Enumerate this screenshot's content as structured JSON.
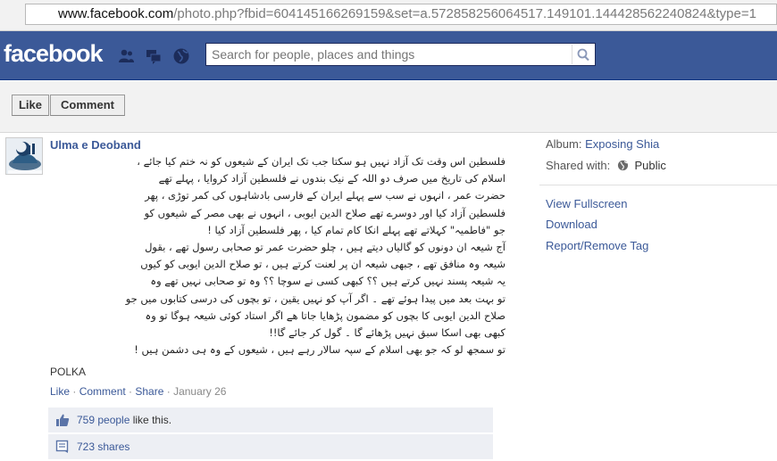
{
  "browser": {
    "url_host": "www.facebook.com",
    "url_rest": "/photo.php?fbid=604145166269159&set=a.572858256064517.149101.144428562240824&type=1"
  },
  "header": {
    "logo": "facebook",
    "search_placeholder": "Search for people, places and things",
    "icons": [
      "friends-icon",
      "messages-icon",
      "notifications-globe-icon",
      "search-icon"
    ]
  },
  "actions": {
    "like_label": "Like",
    "comment_label": "Comment"
  },
  "post": {
    "author": "Ulma e Deoband",
    "caption_lines": [
      "فلسطین اس وقت تک آزاد نہیں ہو سکتا جب تک ایران کے شیعوں کو نہ ختم کیا جائے ،",
      "اسلام کی تاریخ میں صرف دو اللہ کے نیک بندوں نے فلسطین آزاد کروایا ، پہلے تھے",
      "حضرت عمر ، انہوں نے سب سے پہلے ایران کے فارسی بادشاہوں کی کمر توڑی ، پھر",
      "فلسطین آزاد کیا اور دوسرے تھے صلاح الدین ایوبی ، انہوں نے بھی مصر کے شیعوں کو",
      "جو \"فاطمیہ\" کہلاتے تھے پہلے انکا کام تمام کیا ، پھر فلسطین آزاد کیا !",
      "آج شیعہ ان دونوں کو گالیاں دیتے ہیں ، چلو حضرت عمر تو صحابی رسول تھے ، بقول",
      "شیعہ وہ منافق تھے ، جبھی شیعہ ان پر لعنت کرتے ہیں ، تو صلاح الدین ایوبی کو کیوں",
      "یہ شیعہ پسند نہیں کرتے ہیں ؟؟ کبھی کسی نے سوچا ؟؟ وہ تو صحابی نہیں تھے وہ",
      "تو بہت بعد میں پیدا ہوئے تھے ۔ اگر آپ کو نہیں یقین ، تو بچوں کی درسی کتابوں میں جو",
      "صلاح الدین ایوبی کا بچوں کو مضمون پڑھایا جاتا ھے اگر استاد کوئی شیعہ ہوگا تو وہ",
      "کبھی بھی اسکا سبق نہیں پڑھائے گا ۔ گول کر جائے گا!!",
      "تو سمجھ لو کہ جو بھی اسلام کے سپہ سالار رہے ہیں ، شیعوں کے وہ ہی دشمن ہیں !"
    ],
    "signature": "POLKA",
    "meta": {
      "like": "Like",
      "sep": " · ",
      "comment": "Comment",
      "share": "Share",
      "date": "January 26"
    },
    "likes": {
      "count_text": "759 people",
      "suffix": " like this."
    },
    "shares": {
      "count_text": "723 shares"
    }
  },
  "sidebar": {
    "album_label": "Album:",
    "album_name": "Exposing Shia",
    "shared_label": "Shared with:",
    "shared_value": "Public",
    "links": [
      "View Fullscreen",
      "Download",
      "Report/Remove Tag"
    ]
  },
  "colors": {
    "fb_blue": "#3b5998",
    "link": "#3b5998",
    "ufi_bg": "#edeff4"
  }
}
